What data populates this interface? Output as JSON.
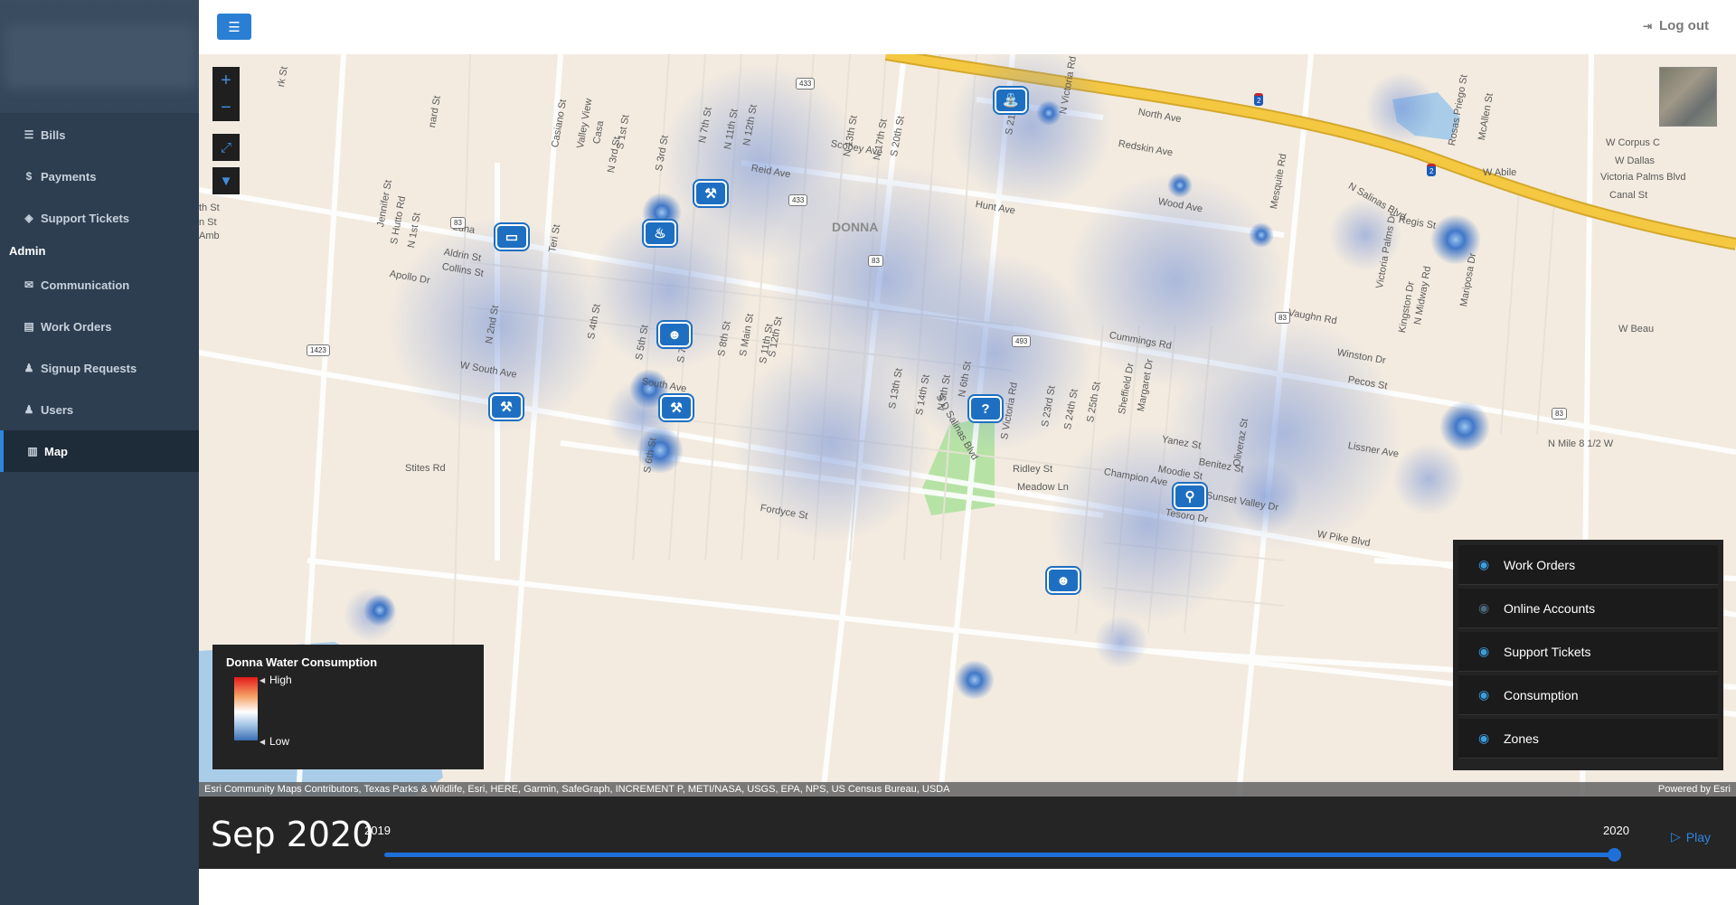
{
  "sidebar": {
    "items": [
      {
        "icon": "list-icon",
        "glyph": "☰",
        "label": "Bills"
      },
      {
        "icon": "dollar-icon",
        "glyph": "$",
        "label": "Payments"
      },
      {
        "icon": "ticket-icon",
        "glyph": "◈",
        "label": "Support Tickets"
      }
    ],
    "admin_section": "Admin",
    "admin_items": [
      {
        "icon": "envelope-icon",
        "glyph": "✉",
        "label": "Communication"
      },
      {
        "icon": "document-icon",
        "glyph": "▤",
        "label": "Work Orders"
      },
      {
        "icon": "user-plus-icon",
        "glyph": "♟",
        "label": "Signup Requests"
      },
      {
        "icon": "users-icon",
        "glyph": "♟",
        "label": "Users"
      },
      {
        "icon": "map-icon",
        "glyph": "▥",
        "label": "Map"
      }
    ],
    "active_item": "Map"
  },
  "topbar": {
    "menu_icon": "hamburger-icon",
    "logout_label": "Log out",
    "logout_icon": "sign-out-icon"
  },
  "map": {
    "place_labels": [
      "DONNA",
      "North Ave",
      "Redskin Ave",
      "Scobey Ave",
      "Reid Ave",
      "Hunt Ave",
      "Wood Ave",
      "Regis St",
      "Luna",
      "Aldrin St",
      "Collins St",
      "Apollo Dr",
      "W South Ave",
      "South Ave",
      "Stites Rd",
      "Fordyce St",
      "Cummings Rd",
      "Pecos St",
      "Winston Dr",
      "Vaughn Rd",
      "Lissner Ave",
      "Yanez St",
      "Benitez St",
      "Moodie St",
      "Ridley St",
      "Meadow Ln",
      "Champion Ave",
      "Sunset Valley Dr",
      "Tesoro Dr",
      "W Pike Blvd",
      "N Mile 8 1/2 W",
      "W Beau",
      "W Abile",
      "W Corpus C",
      "W Dallas",
      "Victoria Palms Blvd",
      "Canal St",
      "N Salinas Blvd",
      "S D Salinas Blvd",
      "N Victoria Rd",
      "S Victoria Rd",
      "Mesquite Rd",
      "Oliveraz St",
      "Teri St",
      "Jennifer St",
      "S Hutto Rd",
      "N 1st St",
      "N 2nd St",
      "N 3rd St",
      "S 1st St",
      "S 3rd St",
      "S 4th St",
      "S 5th St",
      "S 6th St",
      "S 7th St",
      "S 8th St",
      "S Main St",
      "S 11th St",
      "S 12th St",
      "S 13th St",
      "S 14th St",
      "N 5th St",
      "N 6th St",
      "N 7th St",
      "N 11th St",
      "N 12th St",
      "N 13th St",
      "N 17th St",
      "S 20th St",
      "S 21st St",
      "S 23rd St",
      "S 24th St",
      "S 25th St",
      "Sheffield Dr",
      "Margaret Dr",
      "Victoria Palms Dr",
      "Kingston Dr",
      "N Midway Rd",
      "Mariposa Dr",
      "Rosas Priego St",
      "McAllen St",
      "Casiano St",
      "Valley View",
      "Casa",
      "nard St",
      "rk St",
      "th St",
      "n St",
      "Amb"
    ],
    "shields": [
      "83",
      "83",
      "83",
      "83",
      "433",
      "433",
      "493",
      "1423",
      "2",
      "2"
    ],
    "controls": {
      "zoom_in_icon": "plus-icon",
      "zoom_out_icon": "minus-icon",
      "fullscreen_icon": "expand-icon",
      "filter_icon": "filter-icon"
    },
    "pins": [
      {
        "icon": "faucet-icon",
        "glyph": "⛲"
      },
      {
        "icon": "fire-icon",
        "glyph": "♨"
      },
      {
        "icon": "wrench-icon",
        "glyph": "⚒"
      },
      {
        "icon": "card-icon",
        "glyph": "▭"
      },
      {
        "icon": "person-gear-icon",
        "glyph": "☻"
      },
      {
        "icon": "wrench-icon",
        "glyph": "⚒"
      },
      {
        "icon": "wrench-icon",
        "glyph": "⚒"
      },
      {
        "icon": "question-icon",
        "glyph": "?"
      },
      {
        "icon": "pipe-icon",
        "glyph": "⚲"
      },
      {
        "icon": "person-gear-icon",
        "glyph": "☻"
      }
    ],
    "basemap_icon": "satellite-basemap-icon"
  },
  "legend": {
    "title": "Donna Water Consumption",
    "high_label": "High",
    "low_label": "Low",
    "colors": [
      "#e41a1a",
      "#f5a066",
      "#ffffff",
      "#a6c7e6",
      "#3b6fb5"
    ]
  },
  "layers": [
    {
      "label": "Work Orders",
      "visible": true
    },
    {
      "label": "Online Accounts",
      "visible": false
    },
    {
      "label": "Support Tickets",
      "visible": true
    },
    {
      "label": "Consumption",
      "visible": true
    },
    {
      "label": "Zones",
      "visible": true
    }
  ],
  "attribution": {
    "text": "Esri Community Maps Contributors, Texas Parks & Wildlife, Esri, HERE, Garmin, SafeGraph, INCREMENT P, METI/NASA, USGS, EPA, NPS, US Census Bureau, USDA",
    "powered_by": "Powered by Esri"
  },
  "time_slider": {
    "current": "Sep 2020",
    "min_label": "2019",
    "max_label": "2020",
    "play_label": "Play",
    "play_icon": "play-icon",
    "position_fraction": 1.0
  },
  "colors": {
    "sidebar_bg": "#2d3e50",
    "accent": "#2a7fd4",
    "map_bg": "#f3ebe0",
    "highway": "#f5c842",
    "heat_blue": "#3b6fb5"
  }
}
